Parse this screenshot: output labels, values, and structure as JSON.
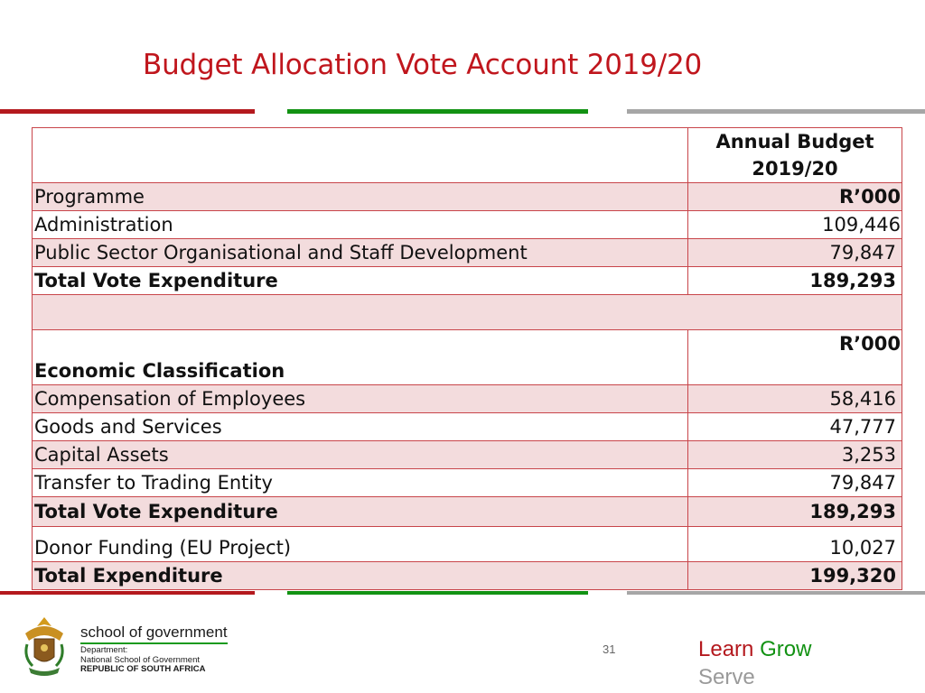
{
  "slide": {
    "title": "Budget Allocation Vote Account 2019/20",
    "page_number": "31"
  },
  "colors": {
    "accent_red": "#b4191e",
    "accent_green": "#129213",
    "accent_grey": "#a6a6a6",
    "row_shade": "#f3dcdd",
    "table_border": "#c8454a"
  },
  "table": {
    "header_line1": "Annual Budget",
    "header_line2": "2019/20",
    "programme": {
      "label": "Programme",
      "unit": "R’000",
      "rows": [
        {
          "label": "Administration",
          "value": "109,446"
        },
        {
          "label": "Public Sector Organisational and Staff Development",
          "value": "79,847"
        }
      ],
      "total_label": "Total Vote Expenditure",
      "total_value": "189,293"
    },
    "economic": {
      "label": "Economic Classification",
      "unit": "R’000",
      "rows": [
        {
          "label": "Compensation of Employees",
          "value": "58,416"
        },
        {
          "label": "Goods and Services",
          "value": "47,777"
        },
        {
          "label": "Capital Assets",
          "value": "3,253"
        },
        {
          "label": "Transfer to Trading Entity",
          "value": "79,847"
        }
      ],
      "total_label": "Total Vote Expenditure",
      "total_value": "189,293"
    },
    "donor": {
      "label": "Donor Funding (EU Project)",
      "value": "10,027"
    },
    "grand_total": {
      "label": "Total Expenditure",
      "value": "199,320"
    }
  },
  "footer": {
    "org_name": "school of government",
    "dept_line1": "Department:",
    "dept_line2": "National School of Government",
    "dept_line3": "REPUBLIC OF SOUTH AFRICA",
    "logo_icon": "coat-of-arms-icon",
    "motto_learn": "Learn",
    "motto_grow": "Grow",
    "motto_serve": "Serve"
  }
}
